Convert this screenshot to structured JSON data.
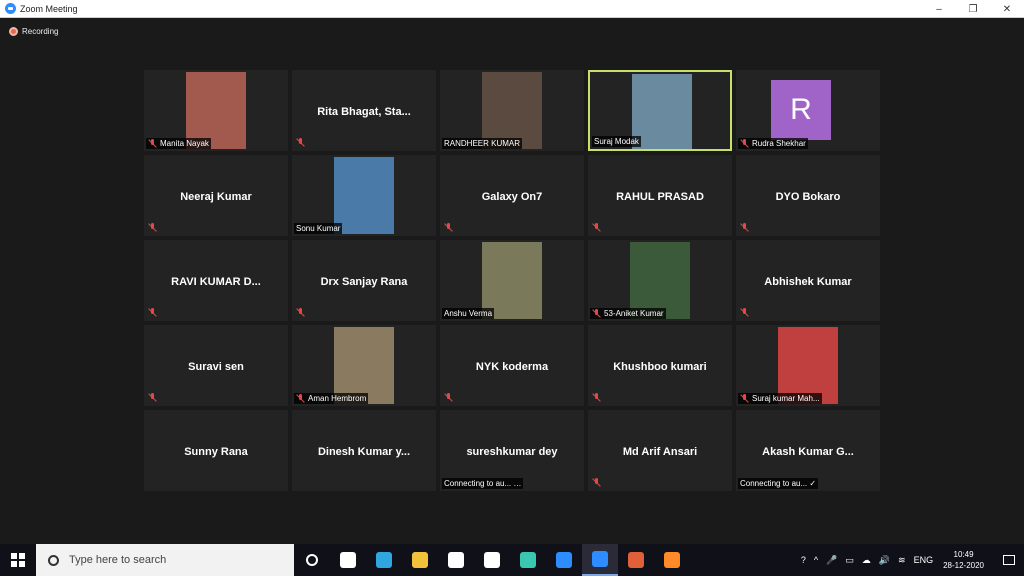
{
  "window": {
    "title": "Zoom Meeting",
    "minimize": "–",
    "restore": "❐",
    "close": "✕"
  },
  "recording": {
    "label": "Recording"
  },
  "participants": [
    {
      "display": "",
      "label": "Manita Nayak",
      "muted": true,
      "photo": true,
      "photo_color": "#a35a4e"
    },
    {
      "display": "Rita Bhagat, Sta...",
      "label": "",
      "muted": true
    },
    {
      "display": "",
      "label": "RANDHEER KUMAR",
      "muted": false,
      "photo": true,
      "photo_color": "#5a4a40"
    },
    {
      "display": "",
      "label": "Suraj Modak",
      "muted": false,
      "photo": true,
      "photo_color": "#6a8aa0",
      "active": true
    },
    {
      "display": "",
      "label": "Rudra Shekhar",
      "muted": true,
      "avatar": "R"
    },
    {
      "display": "Neeraj Kumar",
      "label": "",
      "muted": true
    },
    {
      "display": "",
      "label": "Sonu Kumar",
      "muted": false,
      "photo": true,
      "photo_color": "#4a7aa8"
    },
    {
      "display": "Galaxy On7",
      "label": "",
      "muted": true
    },
    {
      "display": "RAHUL PRASAD",
      "label": "",
      "muted": true
    },
    {
      "display": "DYO Bokaro",
      "label": "",
      "muted": true
    },
    {
      "display": "RAVI KUMAR D...",
      "label": "",
      "muted": true
    },
    {
      "display": "Drx Sanjay Rana",
      "label": "",
      "muted": true
    },
    {
      "display": "",
      "label": "Anshu Verma",
      "muted": false,
      "photo": true,
      "photo_color": "#7a7a5a"
    },
    {
      "display": "",
      "label": "53-Aniket Kumar",
      "muted": true,
      "photo": true,
      "photo_color": "#3a5a3a"
    },
    {
      "display": "Abhishek Kumar",
      "label": "",
      "muted": true
    },
    {
      "display": "Suravi sen",
      "label": "",
      "muted": true
    },
    {
      "display": "",
      "label": "Aman Hembrom",
      "muted": true,
      "photo": true,
      "photo_color": "#8a7a60"
    },
    {
      "display": "NYK koderma",
      "label": "",
      "muted": true
    },
    {
      "display": "Khushboo kumari",
      "label": "",
      "muted": true
    },
    {
      "display": "",
      "label": "Suraj kumar Mah...",
      "muted": true,
      "photo": true,
      "photo_color": "#c04040"
    },
    {
      "display": "Sunny Rana",
      "label": "",
      "muted": false
    },
    {
      "display": "Dinesh Kumar y...",
      "label": "",
      "muted": false
    },
    {
      "display": "sureshkumar dey",
      "label": "Connecting to au... …",
      "muted": false
    },
    {
      "display": "Md Arif Ansari",
      "label": "",
      "muted": true
    },
    {
      "display": "Akash Kumar G...",
      "label": "Connecting to au... ✓",
      "muted": false
    }
  ],
  "taskbar": {
    "search_placeholder": "Type here to search",
    "icons": [
      {
        "name": "cortana-icon",
        "color": "#ffffff"
      },
      {
        "name": "task-view-icon",
        "color": "#ffffff"
      },
      {
        "name": "edge-icon",
        "color": "#2fa6e0"
      },
      {
        "name": "file-explorer-icon",
        "color": "#f3c13a"
      },
      {
        "name": "store-icon",
        "color": "#ffffff"
      },
      {
        "name": "dropbox-icon",
        "color": "#ffffff"
      },
      {
        "name": "infinity-icon",
        "color": "#3ac7b0"
      },
      {
        "name": "mail-icon",
        "color": "#2d8cff"
      },
      {
        "name": "zoom-icon",
        "color": "#2d8cff"
      },
      {
        "name": "presentation-icon",
        "color": "#e0603a"
      },
      {
        "name": "firefox-icon",
        "color": "#ff8a2a"
      }
    ],
    "tray": {
      "lang": "ENG",
      "time": "10:49",
      "date": "28-12-2020"
    }
  }
}
